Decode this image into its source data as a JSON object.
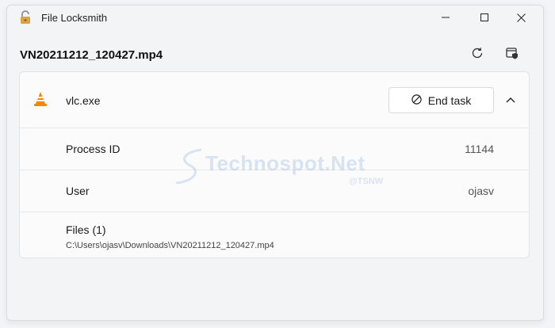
{
  "window": {
    "title": "File Locksmith"
  },
  "header": {
    "file_name": "VN20211212_120427.mp4"
  },
  "process": {
    "name": "vlc.exe",
    "end_task_label": "End task",
    "details": [
      {
        "label": "Process ID",
        "value": "11144"
      },
      {
        "label": "User",
        "value": "ojasv"
      }
    ],
    "files": {
      "label": "Files (1)",
      "path": "C:\\Users\\ojasv\\Downloads\\VN20211212_120427.mp4"
    }
  },
  "watermark": {
    "main": "Technospot.Net",
    "sub": "@TSNW"
  },
  "icons": {
    "app": "padlock-open-icon",
    "minimize": "minimize-icon",
    "maximize": "maximize-icon",
    "close": "close-icon",
    "refresh": "refresh-icon",
    "admin": "run-as-admin-icon",
    "process": "vlc-cone-icon",
    "end_task": "stop-circle-icon",
    "collapse": "chevron-up-icon"
  },
  "colors": {
    "vlc_orange": "#f28a00",
    "window_bg": "#f3f4f6",
    "card_bg": "#fbfbfc"
  }
}
